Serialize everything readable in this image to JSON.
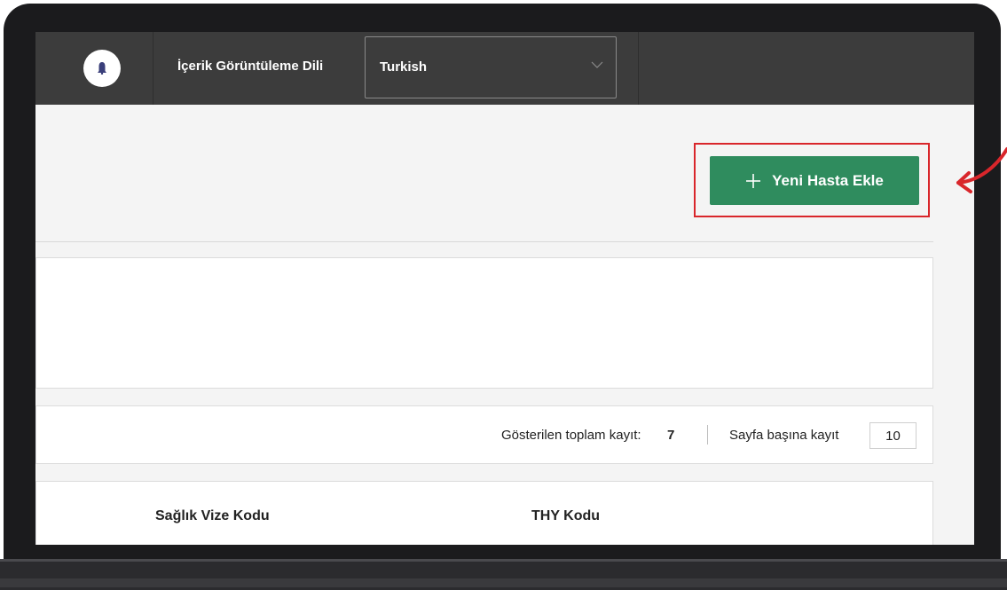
{
  "header": {
    "language_label": "İçerik Görüntüleme Dili",
    "language_value": "Turkish",
    "avatar_icon": "bell-icon"
  },
  "actions": {
    "add_patient_label": "Yeni Hasta Ekle",
    "add_icon": "plus-icon",
    "highlight_color": "#d9262b",
    "button_color": "#2f8c5e"
  },
  "records": {
    "total_label": "Gösterilen toplam kayıt:",
    "total_count": "7",
    "per_page_label": "Sayfa başına kayıt",
    "per_page_value": "10"
  },
  "table": {
    "columns": [
      "Sağlık Vize Kodu",
      "THY Kodu"
    ]
  }
}
